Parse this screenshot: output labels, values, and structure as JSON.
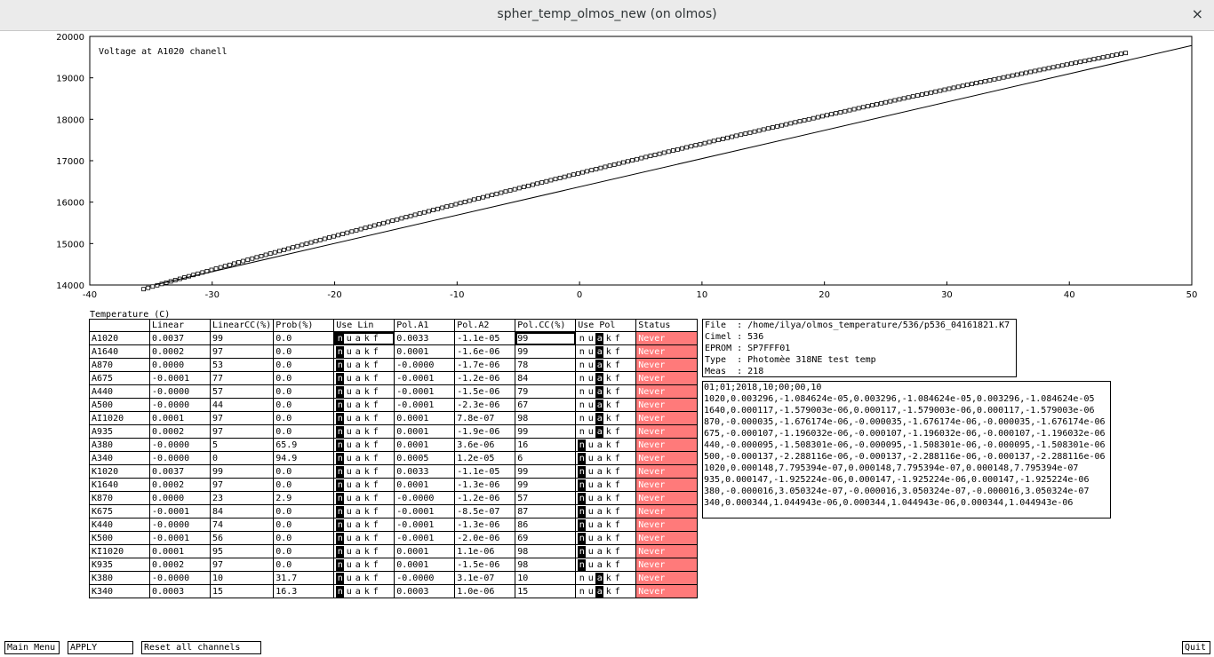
{
  "window": {
    "title": "spher_temp_olmos_new (on olmos)",
    "close_glyph": "×"
  },
  "chart_data": {
    "type": "scatter",
    "title": "Voltage at A1020 chanell",
    "xlabel": "Temperature (C)",
    "ylabel": "",
    "xlim": [
      -40,
      50
    ],
    "ylim": [
      14000,
      20000
    ],
    "xticks": [
      -40,
      -30,
      -20,
      -10,
      0,
      10,
      20,
      30,
      40,
      50
    ],
    "yticks": [
      14000,
      15000,
      16000,
      17000,
      18000,
      19000,
      20000
    ],
    "grid": false,
    "fit_line": {
      "x": [
        -40,
        50
      ],
      "y": [
        13640,
        19780
      ]
    },
    "points": {
      "x_start": -35.6,
      "x_end": 44.6,
      "count": 218
    }
  },
  "table": {
    "headers": [
      "",
      "Linear",
      "LinearCC(%)",
      "Prob(%)",
      "Use Lin",
      "Pol.A1",
      "Pol.A2",
      "Pol.CC(%)",
      "Use Pol",
      "Status"
    ],
    "flag_letters": [
      "n",
      "u",
      "a",
      "k",
      "f"
    ],
    "rows": [
      {
        "ch": "A1020",
        "lin": "0.0037",
        "lcc": "99",
        "prob": "0.0",
        "ul": 0,
        "a1": "0.0033",
        "a2": "-1.1e-05",
        "pcc": "99",
        "up": 2,
        "status": "Never"
      },
      {
        "ch": "A1640",
        "lin": "0.0002",
        "lcc": "97",
        "prob": "0.0",
        "ul": 0,
        "a1": "0.0001",
        "a2": "-1.6e-06",
        "pcc": "99",
        "up": 2,
        "status": "Never"
      },
      {
        "ch": "A870",
        "lin": "0.0000",
        "lcc": "53",
        "prob": "0.0",
        "ul": 0,
        "a1": "-0.0000",
        "a2": "-1.7e-06",
        "pcc": "78",
        "up": 2,
        "status": "Never"
      },
      {
        "ch": "A675",
        "lin": "-0.0001",
        "lcc": "77",
        "prob": "0.0",
        "ul": 0,
        "a1": "-0.0001",
        "a2": "-1.2e-06",
        "pcc": "84",
        "up": 2,
        "status": "Never"
      },
      {
        "ch": "A440",
        "lin": "-0.0000",
        "lcc": "57",
        "prob": "0.0",
        "ul": 0,
        "a1": "-0.0001",
        "a2": "-1.5e-06",
        "pcc": "79",
        "up": 2,
        "status": "Never"
      },
      {
        "ch": "A500",
        "lin": "-0.0000",
        "lcc": "44",
        "prob": "0.0",
        "ul": 0,
        "a1": "-0.0001",
        "a2": "-2.3e-06",
        "pcc": "67",
        "up": 2,
        "status": "Never"
      },
      {
        "ch": "AI1020",
        "lin": "0.0001",
        "lcc": "97",
        "prob": "0.0",
        "ul": 0,
        "a1": "0.0001",
        "a2": "7.8e-07",
        "pcc": "98",
        "up": 2,
        "status": "Never"
      },
      {
        "ch": "A935",
        "lin": "0.0002",
        "lcc": "97",
        "prob": "0.0",
        "ul": 0,
        "a1": "0.0001",
        "a2": "-1.9e-06",
        "pcc": "99",
        "up": 2,
        "status": "Never"
      },
      {
        "ch": "A380",
        "lin": "-0.0000",
        "lcc": "5",
        "prob": "65.9",
        "ul": 0,
        "a1": "0.0001",
        "a2": "3.6e-06",
        "pcc": "16",
        "up": 0,
        "status": "Never"
      },
      {
        "ch": "A340",
        "lin": "-0.0000",
        "lcc": "0",
        "prob": "94.9",
        "ul": 0,
        "a1": "0.0005",
        "a2": "1.2e-05",
        "pcc": "6",
        "up": 0,
        "status": "Never"
      },
      {
        "ch": "K1020",
        "lin": "0.0037",
        "lcc": "99",
        "prob": "0.0",
        "ul": 0,
        "a1": "0.0033",
        "a2": "-1.1e-05",
        "pcc": "99",
        "up": 0,
        "status": "Never"
      },
      {
        "ch": "K1640",
        "lin": "0.0002",
        "lcc": "97",
        "prob": "0.0",
        "ul": 0,
        "a1": "0.0001",
        "a2": "-1.3e-06",
        "pcc": "99",
        "up": 0,
        "status": "Never"
      },
      {
        "ch": "K870",
        "lin": "0.0000",
        "lcc": "23",
        "prob": "2.9",
        "ul": 0,
        "a1": "-0.0000",
        "a2": "-1.2e-06",
        "pcc": "57",
        "up": 0,
        "status": "Never"
      },
      {
        "ch": "K675",
        "lin": "-0.0001",
        "lcc": "84",
        "prob": "0.0",
        "ul": 0,
        "a1": "-0.0001",
        "a2": "-8.5e-07",
        "pcc": "87",
        "up": 0,
        "status": "Never"
      },
      {
        "ch": "K440",
        "lin": "-0.0000",
        "lcc": "74",
        "prob": "0.0",
        "ul": 0,
        "a1": "-0.0001",
        "a2": "-1.3e-06",
        "pcc": "86",
        "up": 0,
        "status": "Never"
      },
      {
        "ch": "K500",
        "lin": "-0.0001",
        "lcc": "56",
        "prob": "0.0",
        "ul": 0,
        "a1": "-0.0001",
        "a2": "-2.0e-06",
        "pcc": "69",
        "up": 0,
        "status": "Never"
      },
      {
        "ch": "KI1020",
        "lin": "0.0001",
        "lcc": "95",
        "prob": "0.0",
        "ul": 0,
        "a1": "0.0001",
        "a2": "1.1e-06",
        "pcc": "98",
        "up": 0,
        "status": "Never"
      },
      {
        "ch": "K935",
        "lin": "0.0002",
        "lcc": "97",
        "prob": "0.0",
        "ul": 0,
        "a1": "0.0001",
        "a2": "-1.5e-06",
        "pcc": "98",
        "up": 0,
        "status": "Never"
      },
      {
        "ch": "K380",
        "lin": "-0.0000",
        "lcc": "10",
        "prob": "31.7",
        "ul": 0,
        "a1": "-0.0000",
        "a2": "3.1e-07",
        "pcc": "10",
        "up": 2,
        "status": "Never"
      },
      {
        "ch": "K340",
        "lin": "0.0003",
        "lcc": "15",
        "prob": "16.3",
        "ul": 0,
        "a1": "0.0003",
        "a2": "1.0e-06",
        "pcc": "15",
        "up": 2,
        "status": "Never"
      }
    ]
  },
  "info": [
    "File  : /home/ilya/olmos_temperature/536/p536_04161821.K7",
    "Cimel : 536",
    "EPROM : SP7FFF01",
    "Type  : Photomèe 318NE test temp",
    "Meas  : 218"
  ],
  "coefficients": [
    "01;01;2018,10;00;00,10",
    "1020,0.003296,-1.084624e-05,0.003296,-1.084624e-05,0.003296,-1.084624e-05",
    "1640,0.000117,-1.579003e-06,0.000117,-1.579003e-06,0.000117,-1.579003e-06",
    "870,-0.000035,-1.676174e-06,-0.000035,-1.676174e-06,-0.000035,-1.676174e-06",
    "675,-0.000107,-1.196032e-06,-0.000107,-1.196032e-06,-0.000107,-1.196032e-06",
    "440,-0.000095,-1.508301e-06,-0.000095,-1.508301e-06,-0.000095,-1.508301e-06",
    "500,-0.000137,-2.288116e-06,-0.000137,-2.288116e-06,-0.000137,-2.288116e-06",
    "1020,0.000148,7.795394e-07,0.000148,7.795394e-07,0.000148,7.795394e-07",
    "935,0.000147,-1.925224e-06,0.000147,-1.925224e-06,0.000147,-1.925224e-06",
    "380,-0.000016,3.050324e-07,-0.000016,3.050324e-07,-0.000016,3.050324e-07",
    "340,0.000344,1.044943e-06,0.000344,1.044943e-06,0.000344,1.044943e-06"
  ],
  "buttons": {
    "main_menu": "Main Menu",
    "apply": "APPLY",
    "reset": "Reset all channels",
    "quit": "Quit"
  }
}
